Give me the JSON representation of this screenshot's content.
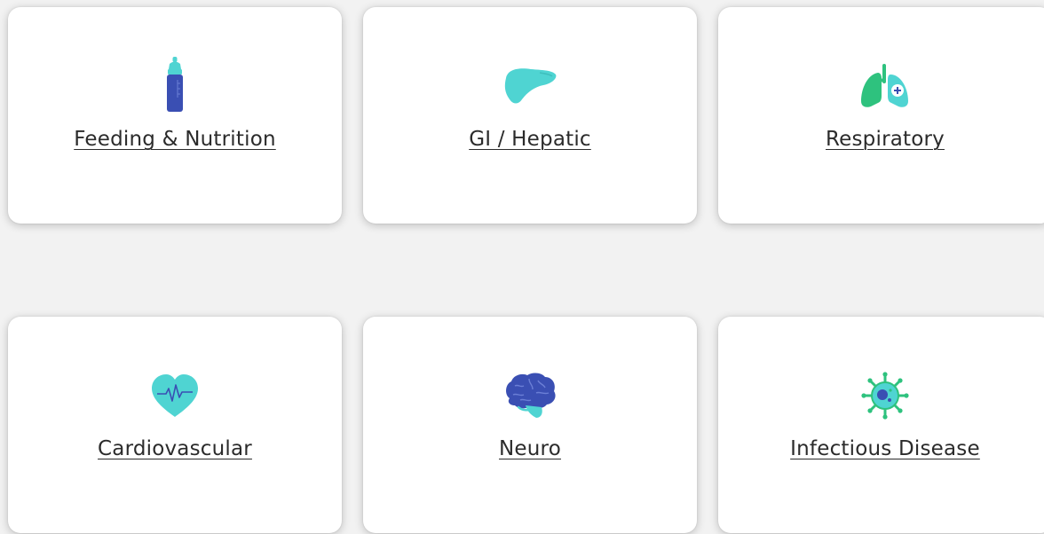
{
  "categories": [
    {
      "label": "Feeding & Nutrition",
      "icon": "baby-bottle-icon"
    },
    {
      "label": "GI / Hepatic",
      "icon": "liver-icon"
    },
    {
      "label": "Respiratory",
      "icon": "lungs-icon"
    },
    {
      "label": "Cardiovascular",
      "icon": "heart-pulse-icon"
    },
    {
      "label": "Neuro",
      "icon": "brain-icon"
    },
    {
      "label": "Infectious Disease",
      "icon": "virus-icon"
    }
  ],
  "colors": {
    "teal": "#4fd4d2",
    "green": "#2ec27e",
    "navy": "#3a4fb3",
    "text": "#2b2b2b",
    "card": "#ffffff",
    "background": "#f2f2f2"
  }
}
